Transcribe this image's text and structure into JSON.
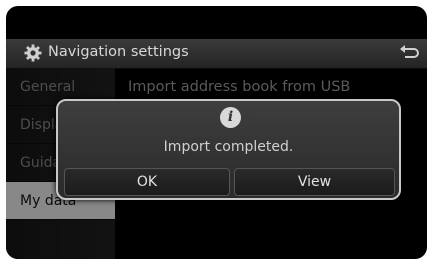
{
  "header": {
    "title": "Navigation settings",
    "settings_icon": "gear-icon",
    "back_icon": "back-arrow-icon"
  },
  "sidebar": {
    "items": [
      {
        "label": "General"
      },
      {
        "label": "Display"
      },
      {
        "label": "Guidance"
      },
      {
        "label": "My data",
        "selected": true
      }
    ]
  },
  "main": {
    "rows": [
      {
        "label": "Import address book from USB"
      }
    ]
  },
  "dialog": {
    "icon": "info-icon",
    "icon_glyph": "i",
    "message": "Import completed.",
    "ok_label": "OK",
    "view_label": "View"
  },
  "colors": {
    "screen_bg": "#000000",
    "active_item_bg": "#d2d2d2",
    "dialog_border": "#c8c8c8"
  }
}
